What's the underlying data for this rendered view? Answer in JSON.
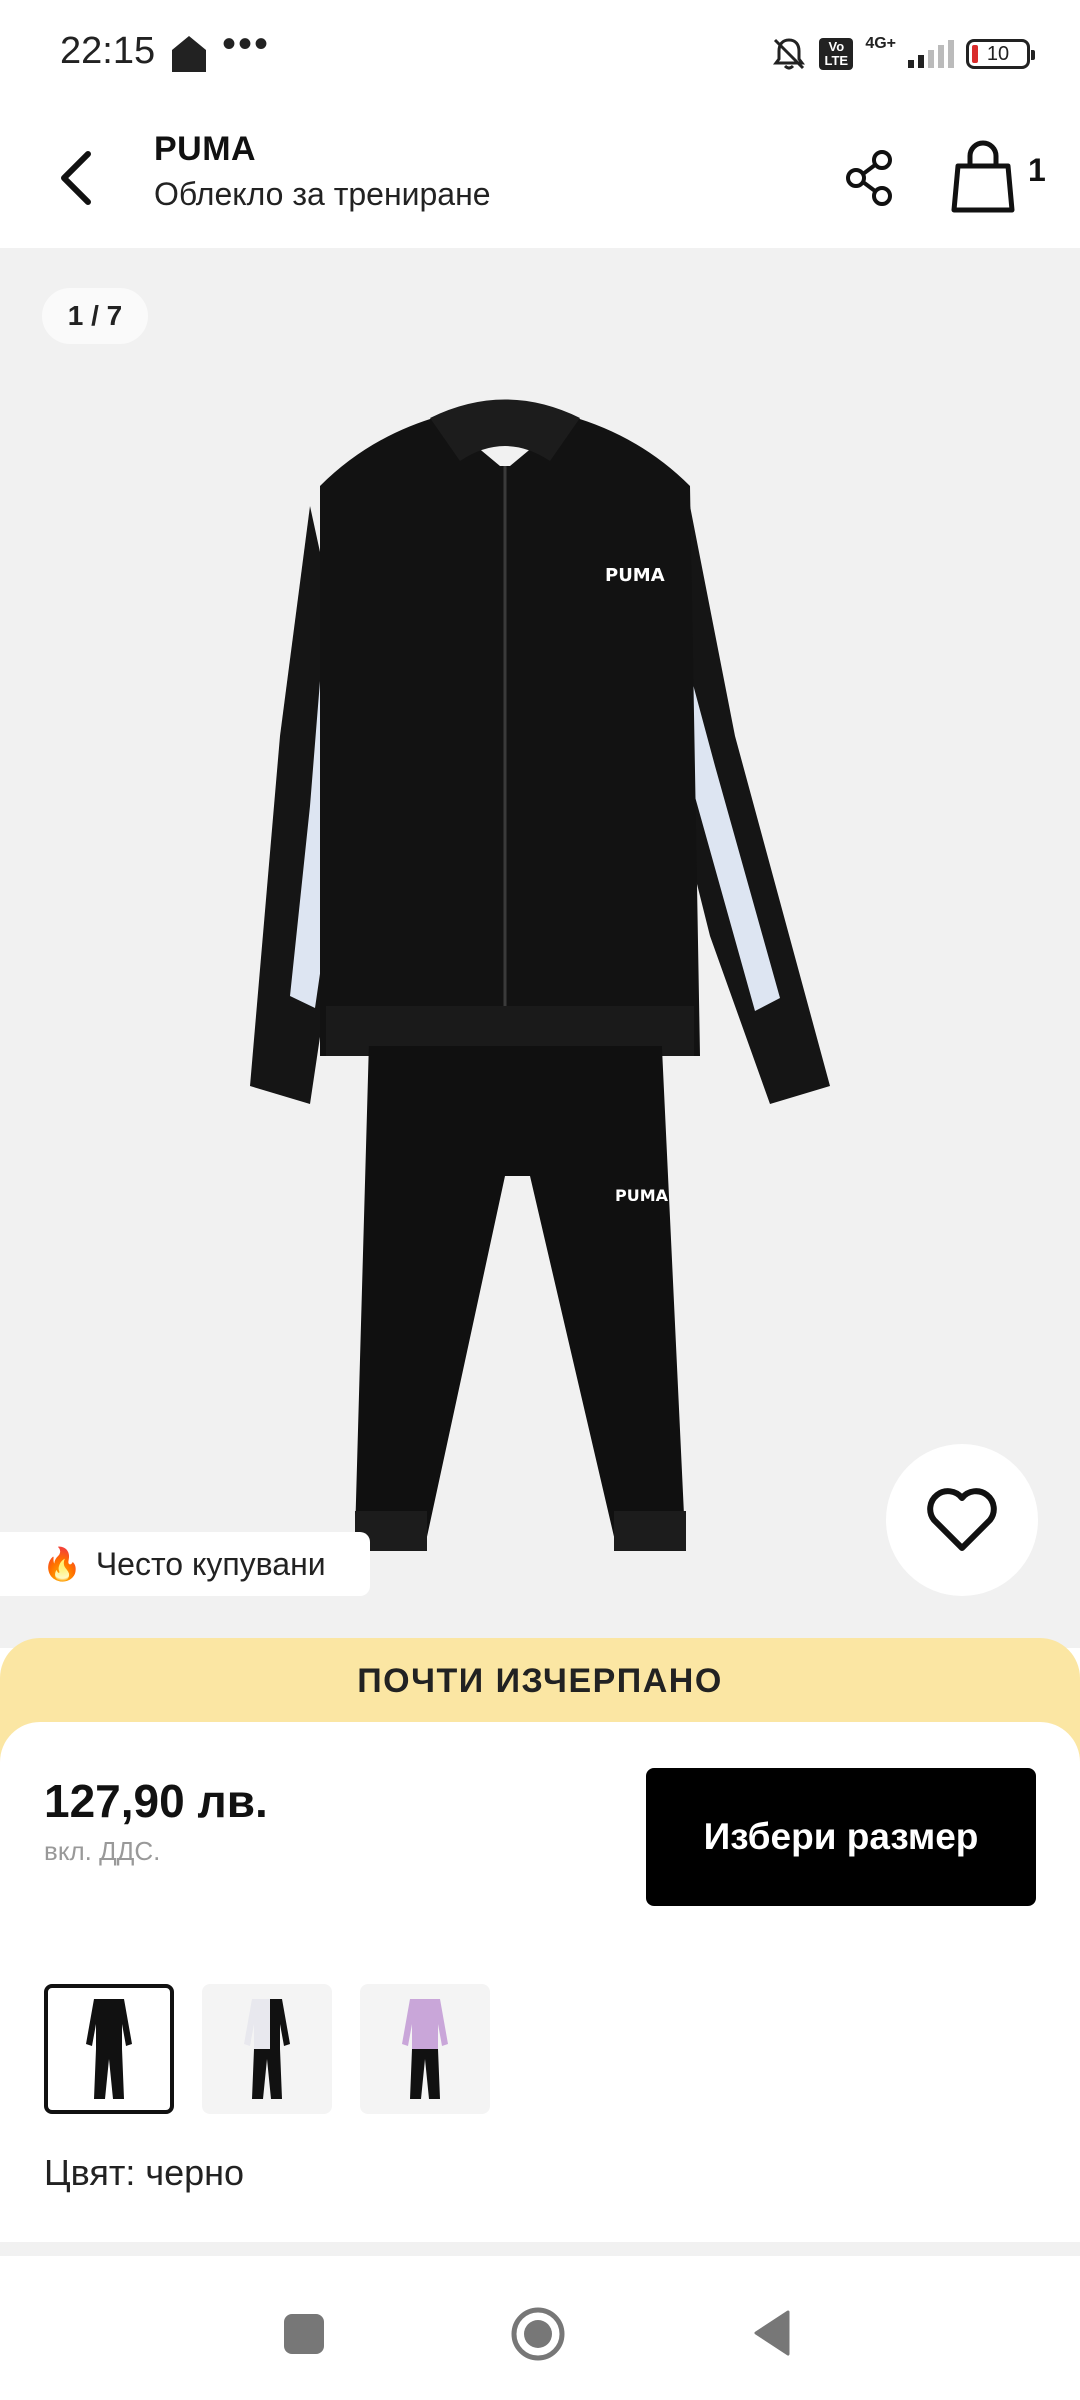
{
  "status": {
    "time": "22:15",
    "dots": "•••",
    "volte": "Vo LTE",
    "network": "4G+",
    "battery": "10"
  },
  "header": {
    "brand": "PUMA",
    "subtitle": "Облекло за трениране",
    "cart_count": "1"
  },
  "gallery": {
    "counter": "1 / 7",
    "badge_icon": "🔥",
    "badge_text": "Често купувани"
  },
  "stock_banner": "ПОЧТИ ИЗЧЕРПАНО",
  "purchase": {
    "price": "127,90 лв.",
    "vat_note": "вкл. ДДС.",
    "size_button": "Избери размер"
  },
  "colors": {
    "label": "Цвят: черно",
    "swatches": [
      "black",
      "black-white",
      "black-lilac"
    ]
  },
  "palette": {
    "banner": "#fbe6a3",
    "gallery_bg": "#f1f1f1",
    "button": "#000000"
  }
}
